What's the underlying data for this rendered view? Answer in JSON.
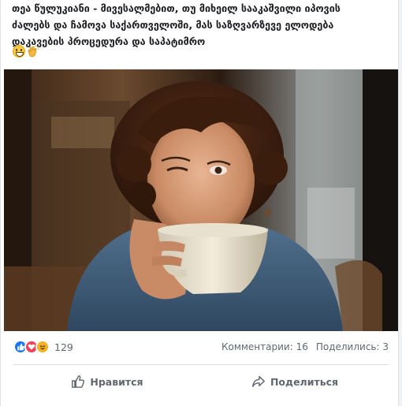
{
  "post": {
    "text_lines": [
      "თეა წულუკიანი - მივესალმებით, თუ მიხეილ სააკაშვილი იპოვის",
      "ძალებს და ჩამოვა საქართველოში, მას საზღვარზევე ელოდება",
      "დაკავების პროცედურა და საპატიმრო"
    ],
    "emojis": [
      "grinning-face-emoji",
      "clapping-hands-emoji"
    ]
  },
  "stats": {
    "reaction_count": "129",
    "comments": "Комментарии: 16",
    "shares": "Поделились: 3"
  },
  "actions": {
    "like_label": "Нравится",
    "share_label": "Поделиться"
  },
  "colors": {
    "like_blue": "#1877f2",
    "love_red": "#f33e58",
    "haha_yellow": "#f7b125",
    "secondary_text": "#606770"
  }
}
